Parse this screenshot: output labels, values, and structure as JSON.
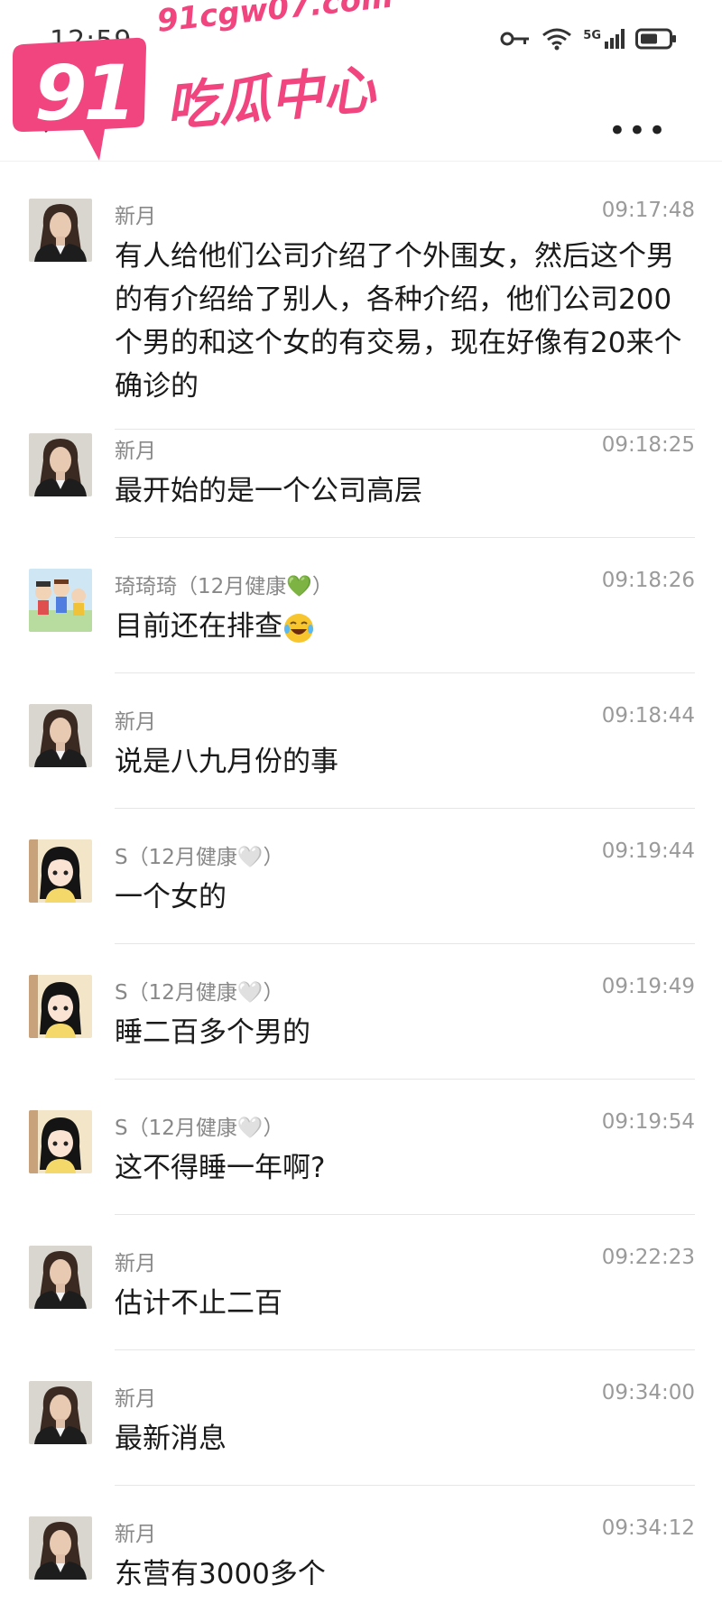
{
  "status_bar": {
    "time": "12:59",
    "network": "5G"
  },
  "watermark": {
    "number": "91",
    "domain": "91cgw07.com",
    "name": "吃瓜中心"
  },
  "nav": {
    "back_icon": "chevron-left-icon",
    "more_icon": "more-dots-icon",
    "more_label": "•••"
  },
  "messages": [
    {
      "sender": "新月",
      "time": "09:17:48",
      "text": "有人给他们公司介绍了个外围女，然后这个男的有介绍给了别人，各种介绍，他们公司200个男的和这个女的有交易，现在好像有20来个确诊的",
      "avatar": "woman-photo"
    },
    {
      "sender": "新月",
      "time": "09:18:25",
      "text": "最开始的是一个公司高层",
      "avatar": "woman-photo"
    },
    {
      "sender": "琦琦琦（12月健康💚）",
      "time": "09:18:26",
      "text": "目前还在排查",
      "emoji": "laughing-tears-emoji",
      "avatar": "cartoon-group"
    },
    {
      "sender": "新月",
      "time": "09:18:44",
      "text": "说是八九月份的事",
      "avatar": "woman-photo"
    },
    {
      "sender": "S（12月健康🤍）",
      "time": "09:19:44",
      "text": "一个女的",
      "avatar": "anime-girl"
    },
    {
      "sender": "S（12月健康🤍）",
      "time": "09:19:49",
      "text": "睡二百多个男的",
      "avatar": "anime-girl"
    },
    {
      "sender": "S（12月健康🤍）",
      "time": "09:19:54",
      "text": "这不得睡一年啊?",
      "avatar": "anime-girl"
    },
    {
      "sender": "新月",
      "time": "09:22:23",
      "text": "估计不止二百",
      "avatar": "woman-photo"
    },
    {
      "sender": "新月",
      "time": "09:34:00",
      "text": "最新消息",
      "avatar": "woman-photo"
    },
    {
      "sender": "新月",
      "time": "09:34:12",
      "text": "东营有3000多个",
      "avatar": "woman-photo"
    }
  ]
}
